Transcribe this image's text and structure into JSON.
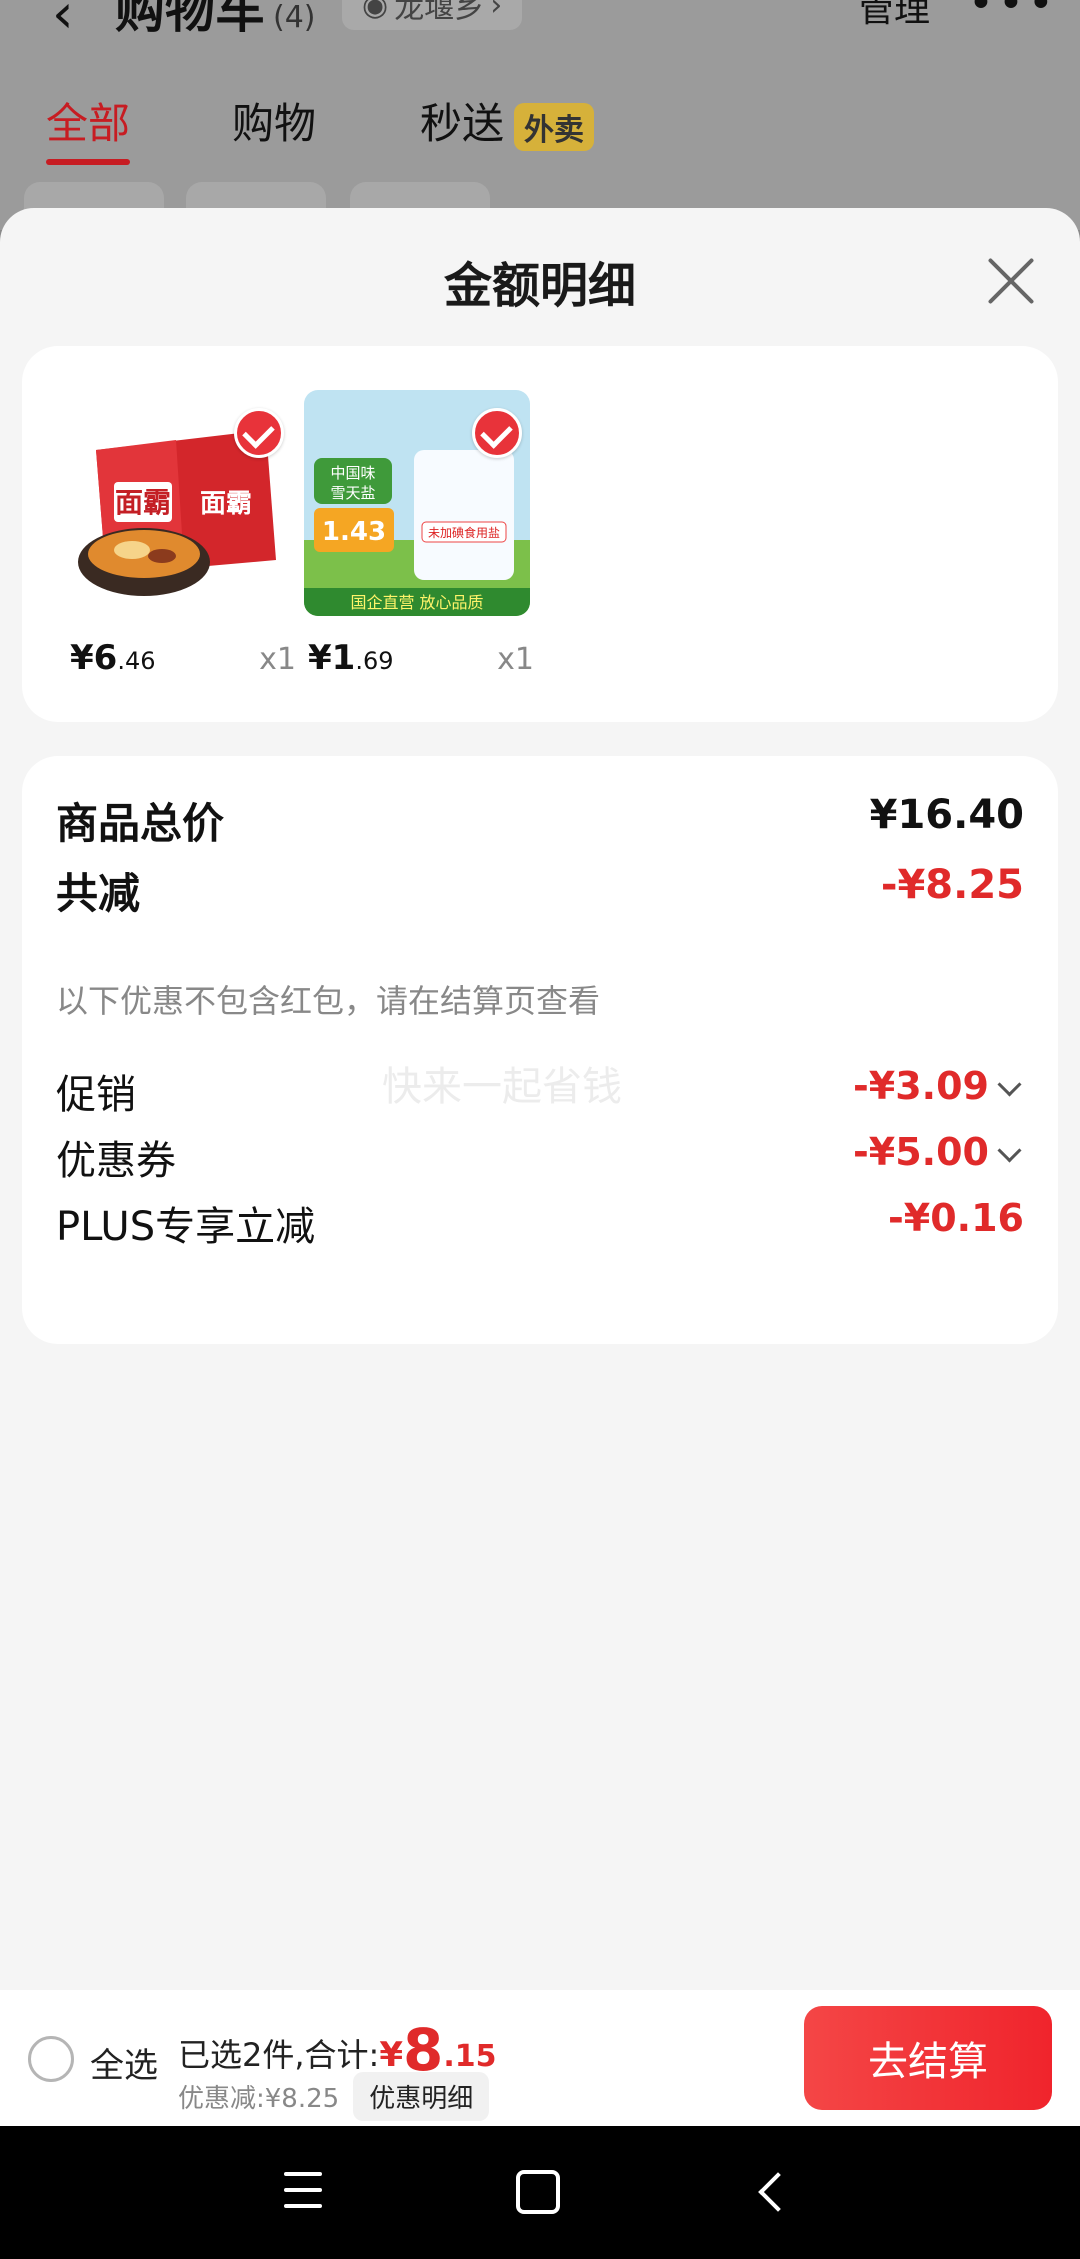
{
  "background": {
    "title": "购物车",
    "count": "(4)",
    "location": "龙堰乡",
    "manage": "管理",
    "tabs": [
      "全部",
      "购物",
      "秒送"
    ],
    "tab_badge": "外卖"
  },
  "sheet": {
    "title": "金额明细"
  },
  "products": [
    {
      "name": "面霸",
      "price_int": "¥6",
      "price_dec": ".46",
      "qty": "x1"
    },
    {
      "name": "雪天盐",
      "price_int": "¥1",
      "price_dec": ".69",
      "qty": "x1"
    }
  ],
  "details": {
    "total_label": "商品总价",
    "total_value": "¥16.40",
    "reduce_label": "共减",
    "reduce_value": "-¥8.25",
    "note": "以下优惠不包含红包，请在结算页查看",
    "watermark": "快来一起省钱",
    "promo_label": "促销",
    "promo_value": "-¥3.09",
    "coupon_label": "优惠券",
    "coupon_value": "-¥5.00",
    "plus_label": "PLUS专享立减",
    "plus_value": "-¥0.16"
  },
  "checkout": {
    "select_all": "全选",
    "selected_text": "已选2件,合计:",
    "currency": "¥",
    "total_int": "8",
    "total_dec": ".15",
    "discount_text": "优惠减:¥8.25",
    "discount_detail": "优惠明细",
    "checkout_button": "去结算"
  },
  "colors": {
    "accent_red": "#e02a2a",
    "button_red": "#f0242c"
  }
}
